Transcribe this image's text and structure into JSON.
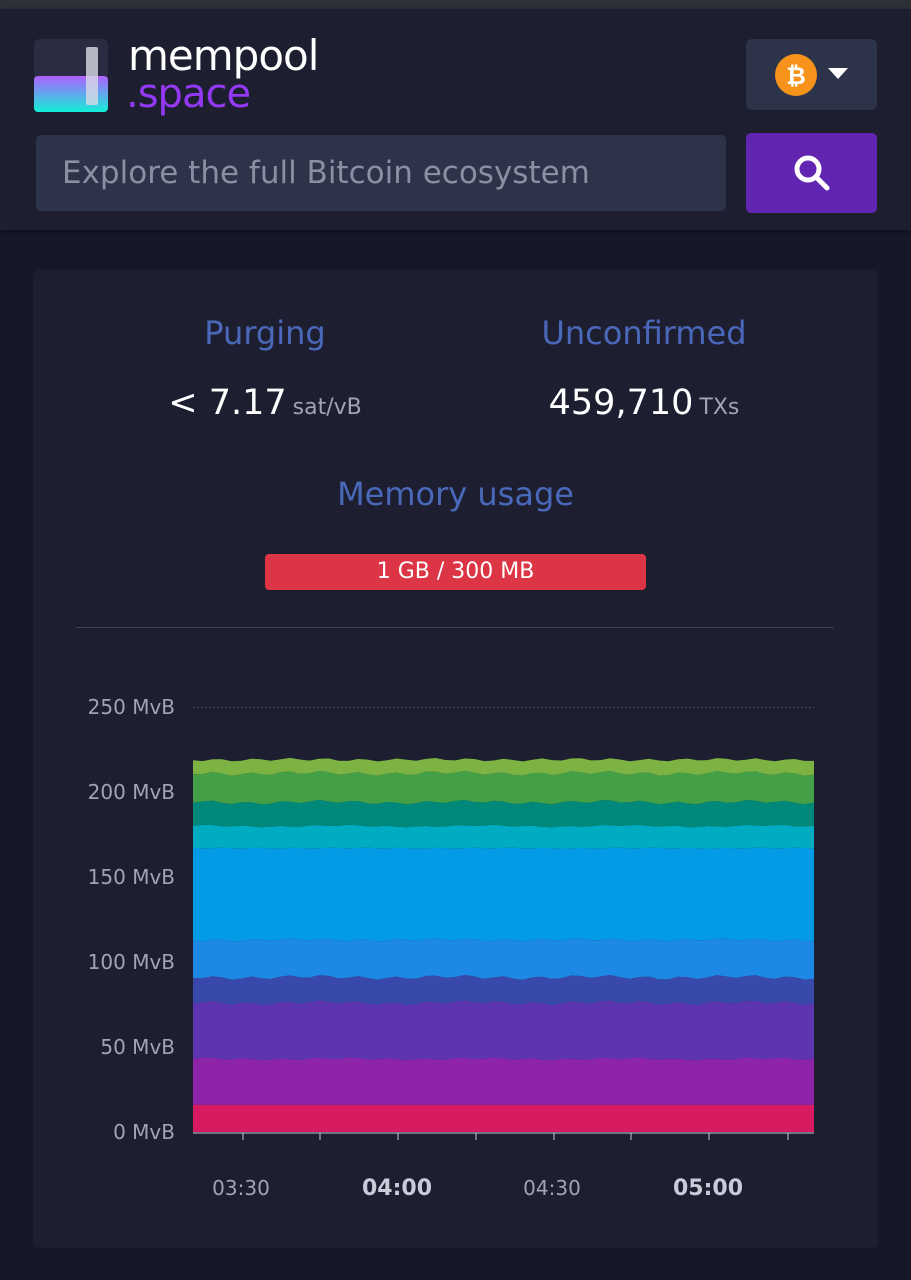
{
  "header": {
    "logo_line1": "mempool",
    "logo_line2": ".space",
    "network_icon": "bitcoin-icon",
    "search_placeholder": "Explore the full Bitcoin ecosystem",
    "search_button_icon": "search-icon"
  },
  "stats": {
    "purging": {
      "title": "Purging",
      "value": "< 7.17",
      "unit": "sat/vB"
    },
    "unconfirmed": {
      "title": "Unconfirmed",
      "value": "459,710",
      "unit": "TXs"
    }
  },
  "memory": {
    "title": "Memory usage",
    "bar_text": "1 GB / 300 MB",
    "bar_color": "#dc3545"
  },
  "colors": {
    "accent_purple": "#6225b2",
    "logo_purple": "#9339f4",
    "title_blue": "#4a68b9"
  },
  "chart_data": {
    "type": "area",
    "stacked": true,
    "y_ticks": [
      "250 MvB",
      "200 MvB",
      "150 MvB",
      "100 MvB",
      "50 MvB",
      "0 MvB"
    ],
    "ylim": [
      0,
      250
    ],
    "x_ticks": [
      {
        "label": "03:30",
        "bold": false
      },
      {
        "label": "04:00",
        "bold": true
      },
      {
        "label": "04:30",
        "bold": false
      },
      {
        "label": "05:00",
        "bold": true
      }
    ],
    "series": [
      {
        "color": "#d81b60",
        "value": 16
      },
      {
        "color": "#8e24aa",
        "value": 27
      },
      {
        "color": "#5e35b1",
        "value": 33
      },
      {
        "color": "#3949ab",
        "value": 15
      },
      {
        "color": "#1e88e5",
        "value": 22
      },
      {
        "color": "#039be5",
        "value": 54
      },
      {
        "color": "#00acc1",
        "value": 13
      },
      {
        "color": "#00897b",
        "value": 14
      },
      {
        "color": "#43a047",
        "value": 17
      },
      {
        "color": "#7cb342",
        "value": 8
      }
    ]
  }
}
